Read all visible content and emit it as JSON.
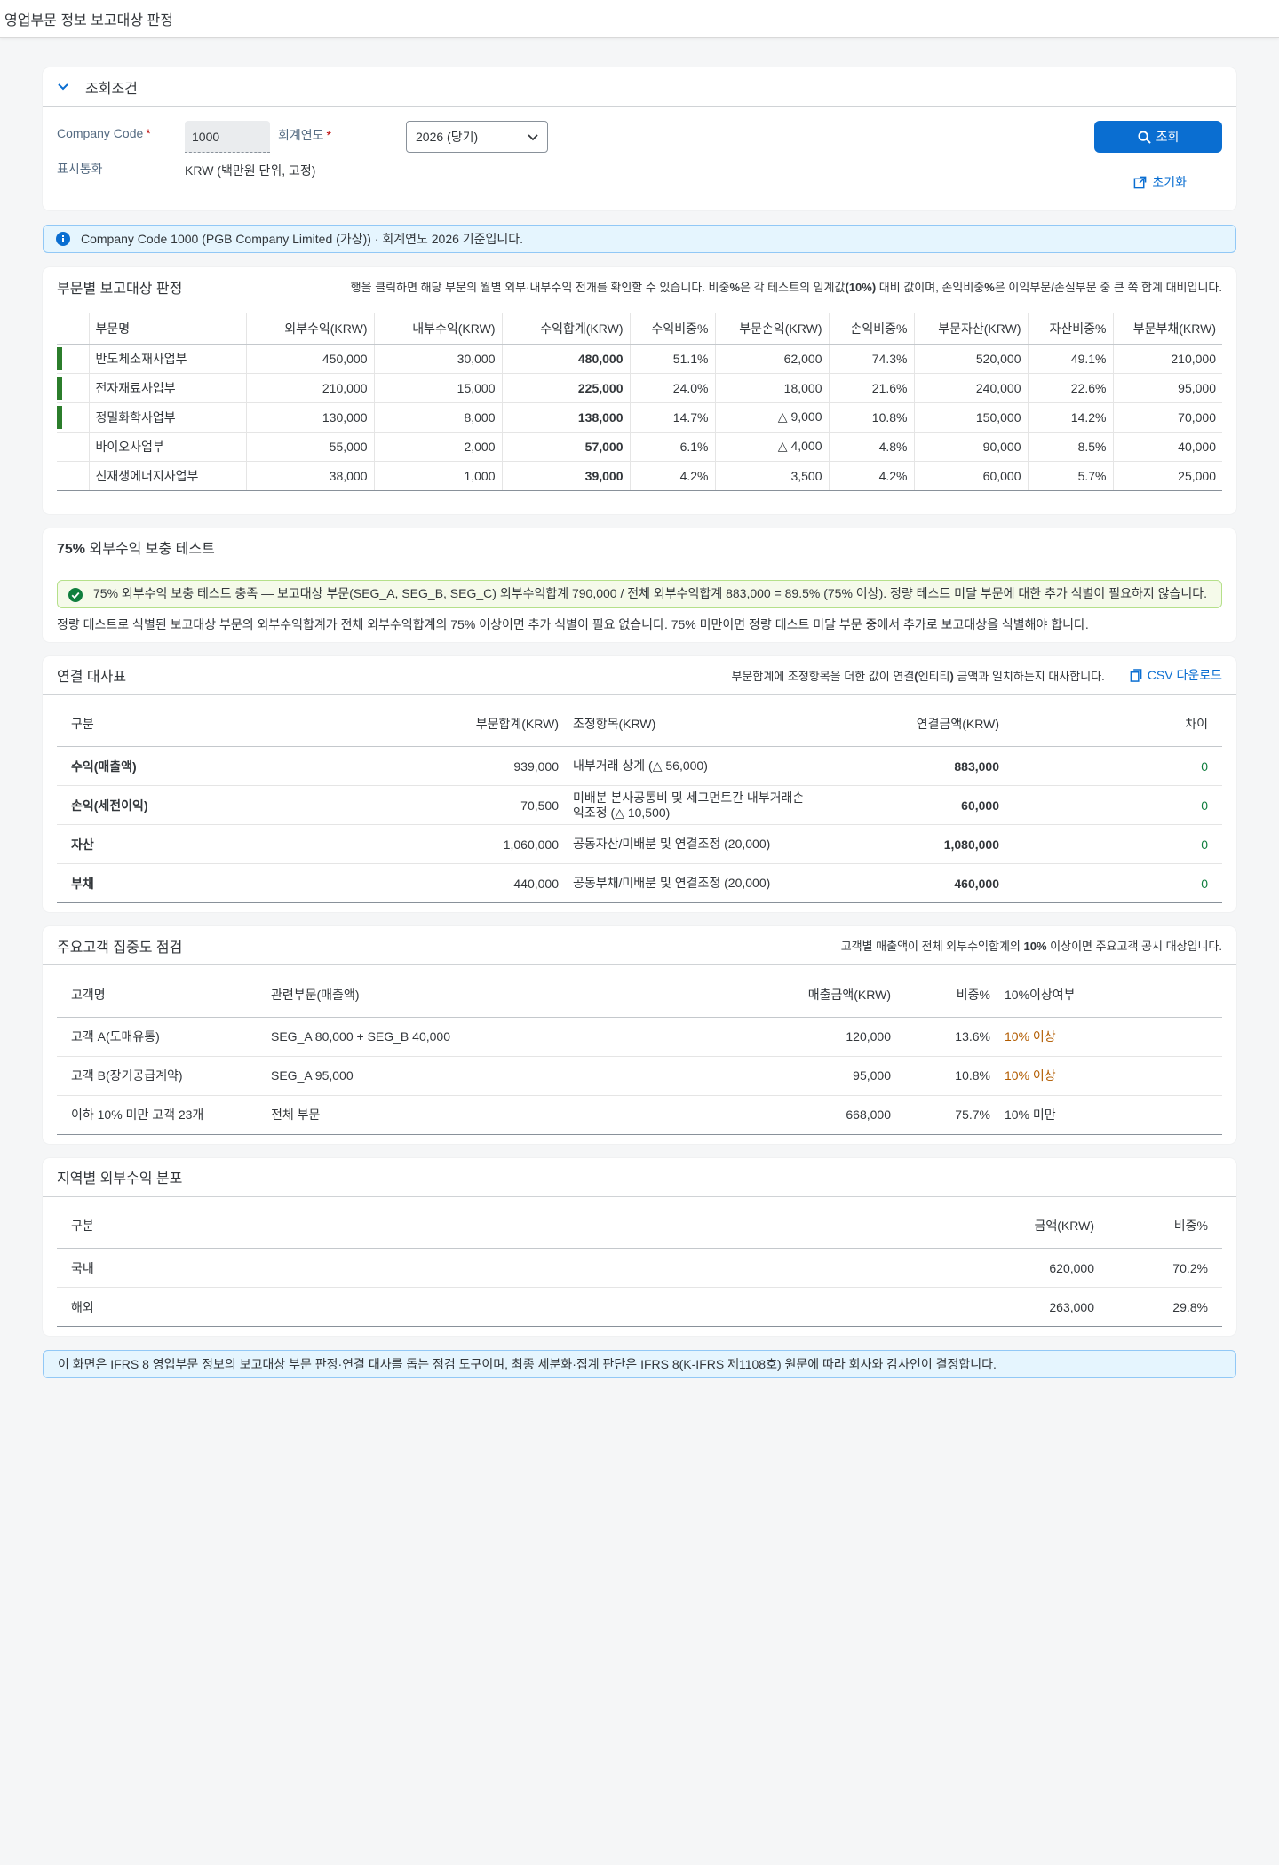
{
  "app": {
    "title": "영업부문 정보 보고대상 판정"
  },
  "filter": {
    "title": "조회조건",
    "company_code_label": "Company Code",
    "company_code_value": "1000",
    "fiscal_year_label": "회계연도",
    "fiscal_year_value": "2026 (당기)",
    "currency_label": "표시통화",
    "currency_value": "KRW (백만원 단위, 고정)",
    "search_label": "조회",
    "reset_label": "초기화"
  },
  "info_message": "Company Code 1000 (PGB Company Limited (가상)) · 회계연도 2026 기준입니다.",
  "segments": {
    "title": "부문별 보고대상 판정",
    "desc_pre": "행을 클릭하면 해당 부문의 월별 외부·내부수익 전개를 확인할 수 있습니다. 비중",
    "desc_b1": "%",
    "desc_mid1": "은 각 테스트의 임계값",
    "desc_b2": "(10%)",
    "desc_mid2": " 대비 값이며, 손익비중",
    "desc_b3": "%",
    "desc_mid3": "은 이익부문",
    "desc_b4": "/",
    "desc_post": "손실부문 중 큰 쪽 합계 대비입니다.",
    "columns": [
      "부문명",
      "외부수익(KRW)",
      "내부수익(KRW)",
      "수익합계(KRW)",
      "수익비중%",
      "부문손익(KRW)",
      "손익비중%",
      "부문자산(KRW)",
      "자산비중%",
      "부문부채(KRW)"
    ],
    "rows": [
      {
        "reportable": true,
        "name": "반도체소재사업부",
        "ext": "450,000",
        "int": "30,000",
        "total": "480,000",
        "rev_pct": "51.1%",
        "pl": "62,000",
        "pl_pct": "74.3%",
        "asset": "520,000",
        "asset_pct": "49.1%",
        "liab": "210,000"
      },
      {
        "reportable": true,
        "name": "전자재료사업부",
        "ext": "210,000",
        "int": "15,000",
        "total": "225,000",
        "rev_pct": "24.0%",
        "pl": "18,000",
        "pl_pct": "21.6%",
        "asset": "240,000",
        "asset_pct": "22.6%",
        "liab": "95,000"
      },
      {
        "reportable": true,
        "name": "정밀화학사업부",
        "ext": "130,000",
        "int": "8,000",
        "total": "138,000",
        "rev_pct": "14.7%",
        "pl": "△ 9,000",
        "pl_pct": "10.8%",
        "asset": "150,000",
        "asset_pct": "14.2%",
        "liab": "70,000"
      },
      {
        "reportable": false,
        "name": "바이오사업부",
        "ext": "55,000",
        "int": "2,000",
        "total": "57,000",
        "rev_pct": "6.1%",
        "pl": "△ 4,000",
        "pl_pct": "4.8%",
        "asset": "90,000",
        "asset_pct": "8.5%",
        "liab": "40,000"
      },
      {
        "reportable": false,
        "name": "신재생에너지사업부",
        "ext": "38,000",
        "int": "1,000",
        "total": "39,000",
        "rev_pct": "4.2%",
        "pl": "3,500",
        "pl_pct": "4.2%",
        "asset": "60,000",
        "asset_pct": "5.7%",
        "liab": "25,000"
      }
    ]
  },
  "test75": {
    "title_bold": "75%",
    "title_rest": " 외부수익 보충 테스트",
    "success_message": "75% 외부수익 보충 테스트 충족 — 보고대상 부문(SEG_A, SEG_B, SEG_C) 외부수익합계 790,000 / 전체 외부수익합계 883,000 = 89.5% (75% 이상). 정량 테스트 미달 부문에 대한 추가 식별이 필요하지 않습니다.",
    "note": "정량 테스트로 식별된 보고대상 부문의 외부수익합계가 전체 외부수익합계의 75% 이상이면 추가 식별이 필요 없습니다. 75% 미만이면 정량 테스트 미달 부문 중에서 추가로 보고대상을 식별해야 합니다."
  },
  "recon": {
    "title": "연결 대사표",
    "desc_pre": "부문합계에 조정항목을 더한 값이 연결",
    "desc_b1": "(",
    "desc_mid": "엔티티",
    "desc_b2": ")",
    "desc_post": " 금액과 일치하는지 대사합니다.",
    "csv_label": "CSV 다운로드",
    "columns": [
      "구분",
      "부문합계(KRW)",
      "조정항목(KRW)",
      "연결금액(KRW)",
      "차이"
    ],
    "rows": [
      {
        "item": "수익(매출액)",
        "seg_total": "939,000",
        "adj": "내부거래 상계 (△ 56,000)",
        "consol": "883,000",
        "diff": "0"
      },
      {
        "item": "손익(세전이익)",
        "seg_total": "70,500",
        "adj": "미배분 본사공통비 및 세그먼트간 내부거래손익조정 (△ 10,500)",
        "consol": "60,000",
        "diff": "0"
      },
      {
        "item": "자산",
        "seg_total": "1,060,000",
        "adj": "공동자산/미배분 및 연결조정 (20,000)",
        "consol": "1,080,000",
        "diff": "0"
      },
      {
        "item": "부채",
        "seg_total": "440,000",
        "adj": "공동부채/미배분 및 연결조정 (20,000)",
        "consol": "460,000",
        "diff": "0"
      }
    ]
  },
  "customers": {
    "title": "주요고객 집중도 점검",
    "desc_pre": "고객별 매출액이 전체 외부수익합계의 ",
    "desc_b": "10%",
    "desc_post": " 이상이면 주요고객 공시 대상입니다.",
    "columns": [
      "고객명",
      "관련부문(매출액)",
      "매출금액(KRW)",
      "비중%",
      "10%이상여부"
    ],
    "rows": [
      {
        "name": "고객 A(도매유통)",
        "seg": "SEG_A 80,000 + SEG_B 40,000",
        "amount": "120,000",
        "pct": "13.6%",
        "flag": "10% 이상",
        "over": true
      },
      {
        "name": "고객 B(장기공급계약)",
        "seg": "SEG_A 95,000",
        "amount": "95,000",
        "pct": "10.8%",
        "flag": "10% 이상",
        "over": true
      },
      {
        "name": "이하 10% 미만 고객 23개",
        "seg": "전체 부문",
        "amount": "668,000",
        "pct": "75.7%",
        "flag": "10% 미만",
        "over": false
      }
    ]
  },
  "regions": {
    "title": "지역별 외부수익 분포",
    "columns": [
      "구분",
      "금액(KRW)",
      "비중%"
    ],
    "rows": [
      {
        "name": "국내",
        "amount": "620,000",
        "pct": "70.2%"
      },
      {
        "name": "해외",
        "amount": "263,000",
        "pct": "29.8%"
      }
    ]
  },
  "footer_note": "이 화면은 IFRS 8 영업부문 정보의 보고대상 부문 판정·연결 대사를 돕는 점검 도구이며, 최종 세분화·집계 판단은 IFRS 8(K-IFRS 제1108호) 원문에 따라 회사와 감사인이 결정합니다.",
  "colors": {
    "brand": "#0a6ed1",
    "reportable": "#2b7d2b",
    "ok": "#107e3e",
    "warn": "#b25c00"
  }
}
